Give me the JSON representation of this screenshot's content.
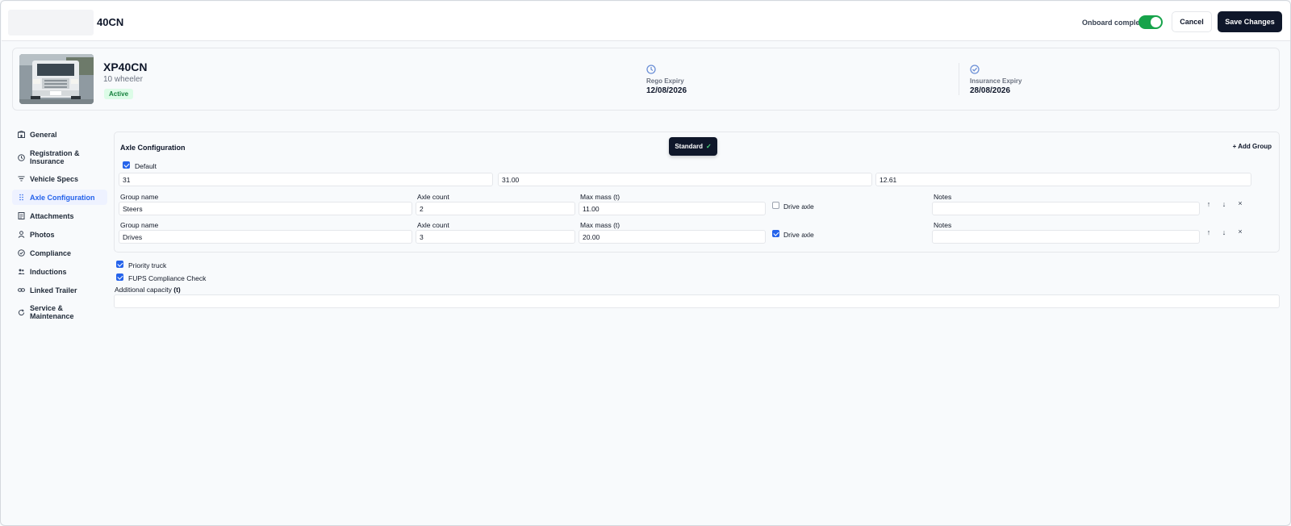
{
  "header": {
    "title": "40CN",
    "onboard_label": "Onboard completed",
    "onboard_toggle_on": true,
    "cancel_label": "Cancel",
    "save_label": "Save Changes"
  },
  "vehicle": {
    "name": "XP40CN",
    "type": "10 wheeler",
    "status": "Active",
    "rego_label": "Rego Expiry",
    "rego_date": "12/08/2026",
    "insurance_label": "Insurance Expiry",
    "insurance_date": "28/08/2026"
  },
  "sidebar": {
    "items": [
      {
        "label": "General",
        "icon": "building-icon",
        "active": false
      },
      {
        "label": "Registration & Insurance",
        "icon": "clock-icon",
        "active": false
      },
      {
        "label": "Vehicle Specs",
        "icon": "filter-icon",
        "active": false
      },
      {
        "label": "Axle Configuration",
        "icon": "grip-icon",
        "active": true
      },
      {
        "label": "Attachments",
        "icon": "document-icon",
        "active": false
      },
      {
        "label": "Photos",
        "icon": "person-icon",
        "active": false
      },
      {
        "label": "Compliance",
        "icon": "check-circle-icon",
        "active": false
      },
      {
        "label": "Inductions",
        "icon": "users-icon",
        "active": false
      },
      {
        "label": "Linked Trailer",
        "icon": "link-icon",
        "active": false
      },
      {
        "label": "Service & Maintenance",
        "icon": "refresh-icon",
        "active": false
      }
    ]
  },
  "axle_config": {
    "title": "Axle Configuration",
    "standard_label": "Standard",
    "standard_check": "✓",
    "add_group_label": "+ Add Group",
    "default_label": "Default",
    "default_checked": true,
    "summary": [
      "31",
      "31.00",
      "12.61"
    ],
    "labels": {
      "group_name": "Group name",
      "axle_count": "Axle count",
      "max_mass": "Max mass (t)",
      "drive_axle": "Drive axle",
      "notes": "Notes"
    },
    "groups": [
      {
        "name": "Steers",
        "axle_count": "2",
        "max_mass": "11.00",
        "drive_axle": false,
        "notes": ""
      },
      {
        "name": "Drives",
        "axle_count": "3",
        "max_mass": "20.00",
        "drive_axle": true,
        "notes": ""
      }
    ],
    "icons": {
      "up": "↑",
      "down": "↓",
      "remove": "×"
    }
  },
  "options": {
    "priority_truck_label": "Priority truck",
    "priority_truck_checked": true,
    "fups_label": "FUPS Compliance Check",
    "fups_checked": true,
    "additional_capacity_label": "Additional capacity",
    "additional_capacity_unit": "(t)",
    "additional_capacity_value": ""
  },
  "colors": {
    "accent": "#2563eb",
    "primary": "#0f172a",
    "toggle_on": "#16a34a",
    "badge_bg": "#dcfce7",
    "badge_text": "#15803d"
  }
}
